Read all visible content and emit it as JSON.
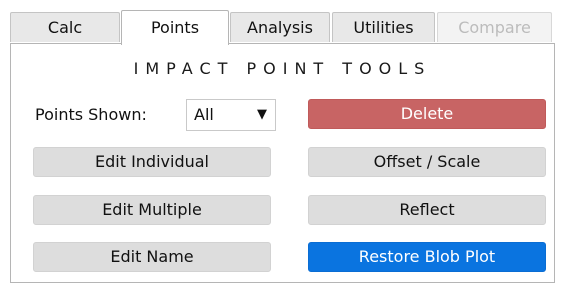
{
  "tabs": [
    {
      "label": "Calc",
      "state": "normal"
    },
    {
      "label": "Points",
      "state": "active"
    },
    {
      "label": "Analysis",
      "state": "normal"
    },
    {
      "label": "Utilities",
      "state": "normal"
    },
    {
      "label": "Compare",
      "state": "disabled"
    }
  ],
  "panel": {
    "title": "IMPACT POINT TOOLS",
    "points_shown_label": "Points Shown:",
    "points_shown_value": "All",
    "dropdown_arrow": "▼"
  },
  "buttons": {
    "edit_individual": "Edit Individual",
    "edit_multiple": "Edit Multiple",
    "edit_name": "Edit Name",
    "delete": "Delete",
    "offset_scale": "Offset / Scale",
    "reflect": "Reflect",
    "restore_blob_plot": "Restore Blob Plot"
  },
  "colors": {
    "delete_button": "#c86464",
    "restore_button": "#0a74e0",
    "neutral_button": "#dddddd"
  }
}
